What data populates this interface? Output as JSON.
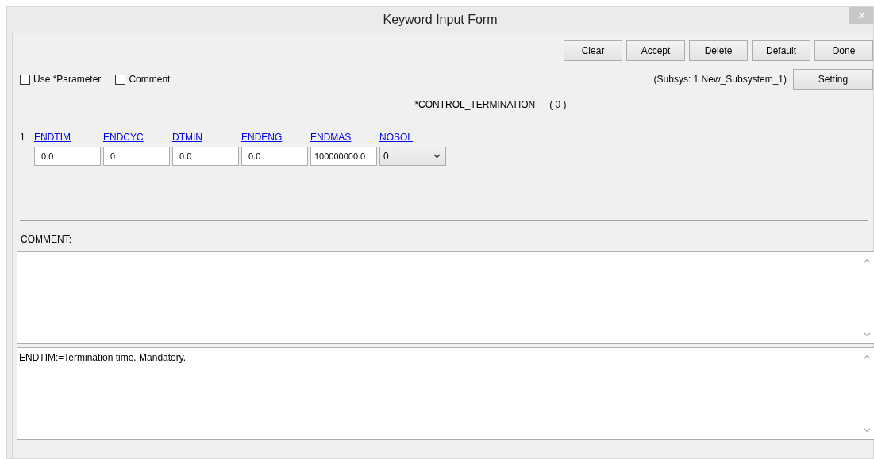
{
  "window": {
    "title": "Keyword Input Form"
  },
  "buttons": [
    "Clear",
    "Accept",
    "Delete",
    "Default",
    "Done"
  ],
  "options": [
    {
      "label": "Use *Parameter",
      "checked": false
    },
    {
      "label": "Comment",
      "checked": false
    }
  ],
  "subsystem": "(Subsys: 1 New_Subsystem_1)",
  "setting_button": "Setting",
  "keyword": "*CONTROL_TERMINATION",
  "count": "( 0 )",
  "card": {
    "number": "1",
    "fields": [
      {
        "name": "ENDTIM",
        "kind": "input",
        "value": "0.0"
      },
      {
        "name": "ENDCYC",
        "kind": "input",
        "value": "0"
      },
      {
        "name": "DTMIN",
        "kind": "input",
        "value": "0.0"
      },
      {
        "name": "ENDENG",
        "kind": "input",
        "value": "0.0"
      },
      {
        "name": "ENDMAS",
        "kind": "input",
        "value": "100000000.0"
      },
      {
        "name": "NOSOL",
        "kind": "select",
        "value": "0"
      }
    ]
  },
  "comment_label": "COMMENT:",
  "help_text": "ENDTIM:=Termination time. Mandatory."
}
